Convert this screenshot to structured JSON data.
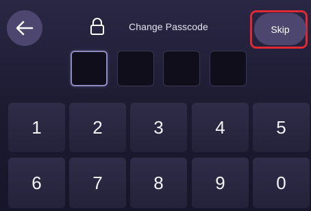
{
  "header": {
    "title": "Change Passcode",
    "skip_label": "Skip",
    "back_icon": "arrow-left-icon",
    "lock_icon": "lock-icon"
  },
  "passcode": {
    "length": 4,
    "entered": 0
  },
  "keypad": {
    "row1": [
      "1",
      "2",
      "3",
      "4",
      "5"
    ],
    "row2": [
      "6",
      "7",
      "8",
      "9",
      "0"
    ]
  },
  "colors": {
    "background": "#1c1a30",
    "button_fill": "#4d476f",
    "highlight_border": "#e02933",
    "key_fill": "#2a2840"
  }
}
